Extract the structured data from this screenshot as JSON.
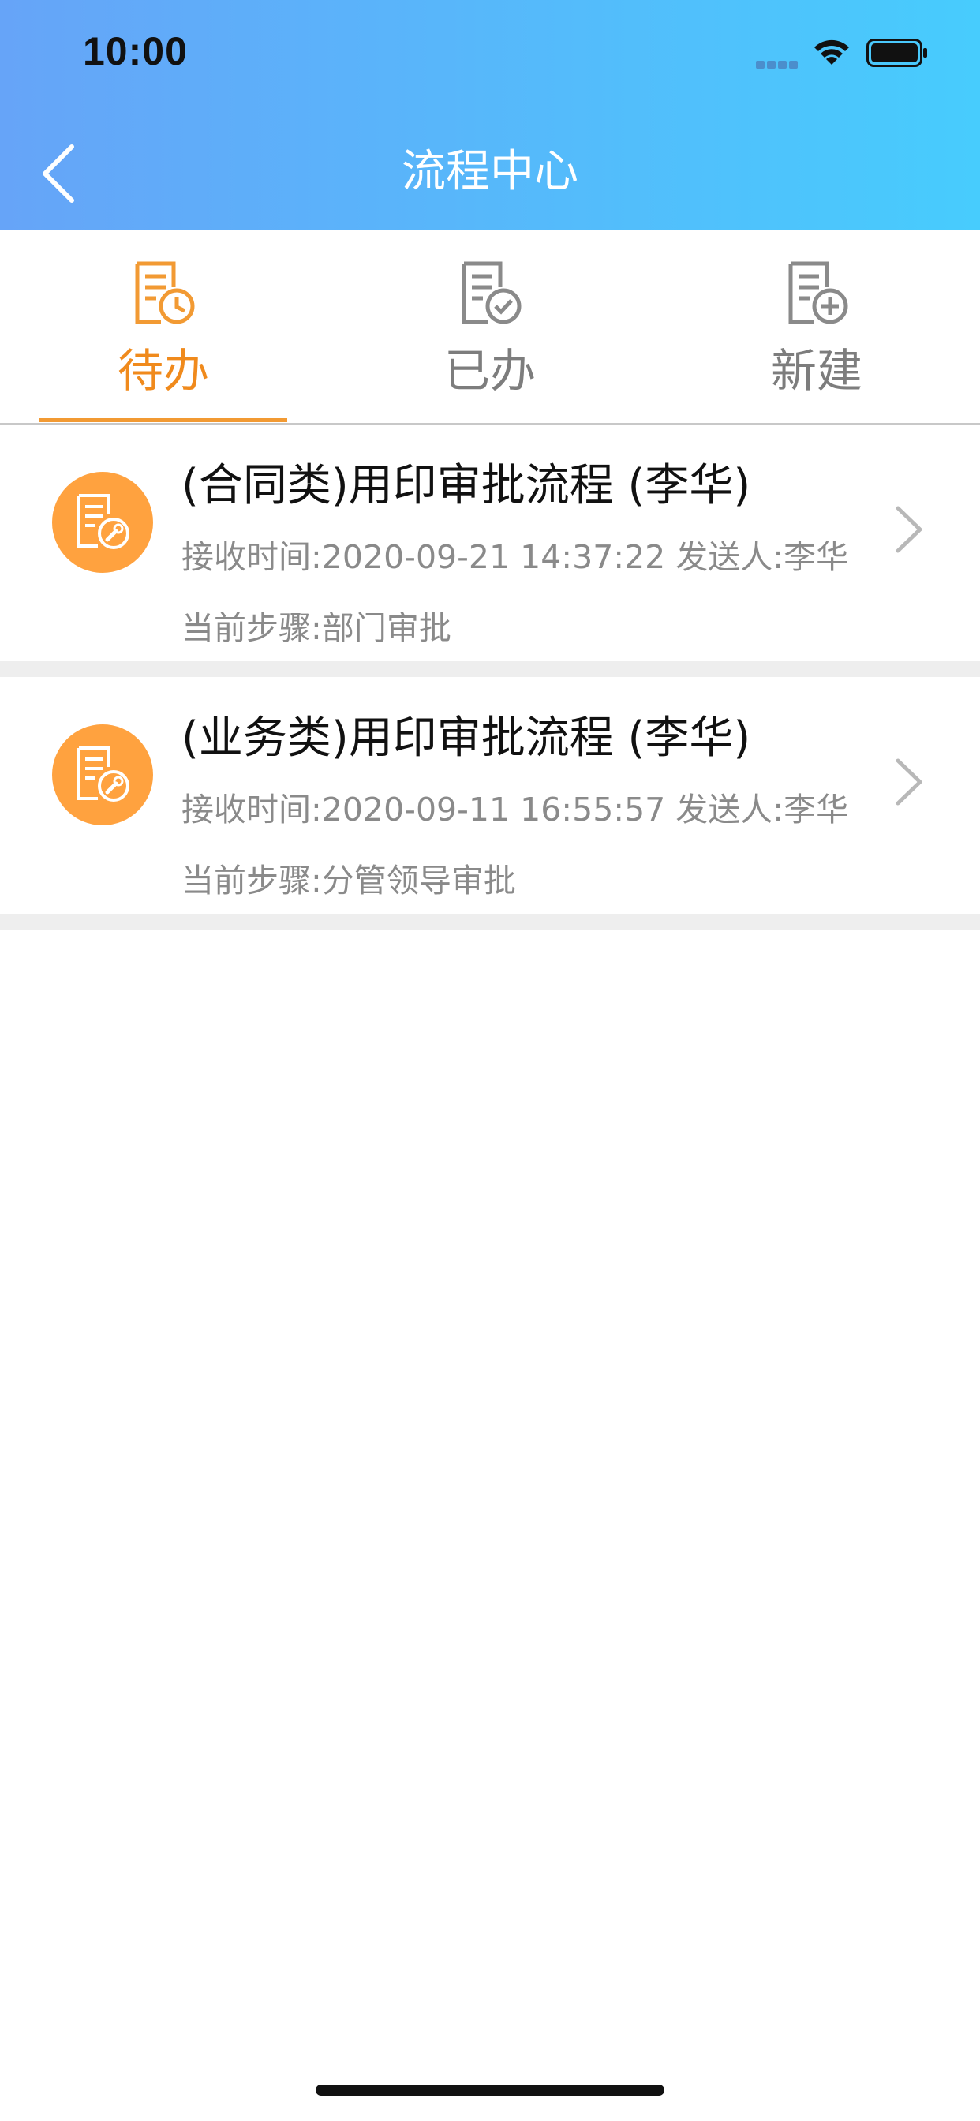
{
  "status_bar": {
    "time": "10:00"
  },
  "nav": {
    "title": "流程中心",
    "back_icon": "chevron-left-icon"
  },
  "tabs": [
    {
      "label": "待办",
      "icon": "document-clock-icon",
      "active": true
    },
    {
      "label": "已办",
      "icon": "document-check-icon",
      "active": false
    },
    {
      "label": "新建",
      "icon": "document-plus-icon",
      "active": false
    }
  ],
  "items": [
    {
      "title": "(合同类)用印审批流程 (李华)",
      "meta": "接收时间:2020-09-21 14:37:22 发送人:李华",
      "step": "当前步骤:部门审批",
      "icon": "document-wrench-icon"
    },
    {
      "title": "(业务类)用印审批流程 (李华)",
      "meta": "接收时间:2020-09-11 16:55:57 发送人:李华",
      "step": "当前步骤:分管领导审批",
      "icon": "document-wrench-icon"
    }
  ],
  "colors": {
    "header_gradient_start": "#66a4f8",
    "header_gradient_end": "#47ccfd",
    "accent": "#f08a1c",
    "avatar_bg": "#ffa23f",
    "inactive_tab": "#7d7d7d"
  }
}
